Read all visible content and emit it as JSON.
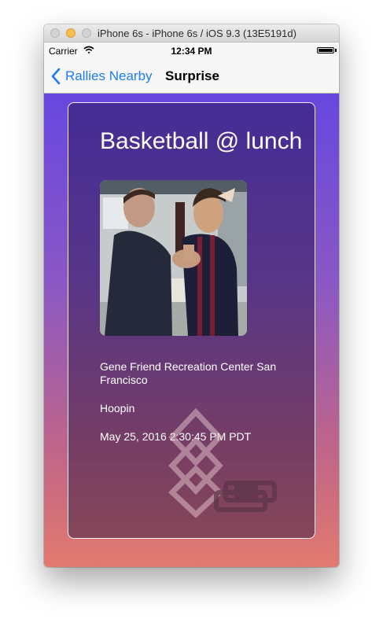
{
  "window": {
    "title": "iPhone 6s - iPhone 6s / iOS 9.3 (13E5191d)"
  },
  "status_bar": {
    "carrier": "Carrier",
    "time": "12:34 PM"
  },
  "nav": {
    "back_label": "Rallies Nearby",
    "title": "Surprise"
  },
  "rally": {
    "title": "Basketball @ lunch",
    "location": "Gene Friend Recreation Center San Francisco",
    "activity": "Hoopin",
    "datetime": "May 25, 2016 2:30:45 PM PDT"
  },
  "colors": {
    "gradient_top": "#6747e0",
    "gradient_bottom": "#e27a6e",
    "link_blue": "#1e7cf0",
    "minimize_yellow": "#f5be4f"
  },
  "icons": {
    "back": "chevron-left-icon",
    "wifi": "wifi-icon",
    "battery": "battery-icon",
    "watermark": "diamond-stack-logo"
  }
}
